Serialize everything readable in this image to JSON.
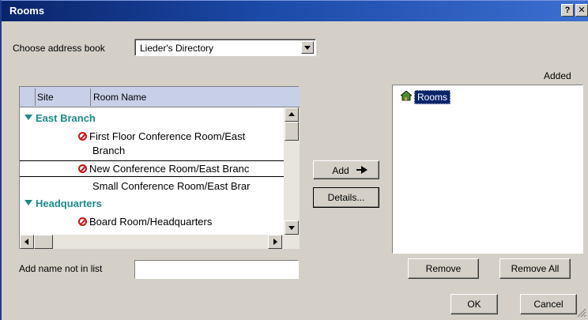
{
  "window": {
    "title": "Rooms",
    "help_label": "?",
    "close_label": "✕"
  },
  "address_book": {
    "label": "Choose address book",
    "value": "Lieder's Directory"
  },
  "rooms_list": {
    "columns": [
      "Site",
      "Room Name"
    ],
    "groups": [
      {
        "name": "East Branch",
        "rooms": [
          {
            "line1": "First Floor Conference Room/East",
            "line2": "Branch",
            "status_icon": "no-entry-icon"
          },
          {
            "line1": "New Conference Room/East Branc",
            "status_icon": "no-entry-icon"
          },
          {
            "line1": "Small Conference Room/East Brar",
            "status_icon": ""
          }
        ]
      },
      {
        "name": "Headquarters",
        "rooms": [
          {
            "line1": "Board Room/Headquarters",
            "status_icon": "no-entry-icon"
          }
        ]
      }
    ]
  },
  "add_name": {
    "label": "Add name not in list",
    "value": ""
  },
  "actions": {
    "add_label": "Add",
    "details_label": "Details..."
  },
  "added": {
    "header": "Added",
    "items": [
      "Rooms"
    ]
  },
  "bottom": {
    "remove_label": "Remove",
    "remove_all_label": "Remove All",
    "ok_label": "OK",
    "cancel_label": "Cancel"
  },
  "colors": {
    "titlebar": "#0a246a",
    "group_text": "#1a8a8a",
    "no_entry": "#cc1111",
    "selection": "#0a246a"
  }
}
